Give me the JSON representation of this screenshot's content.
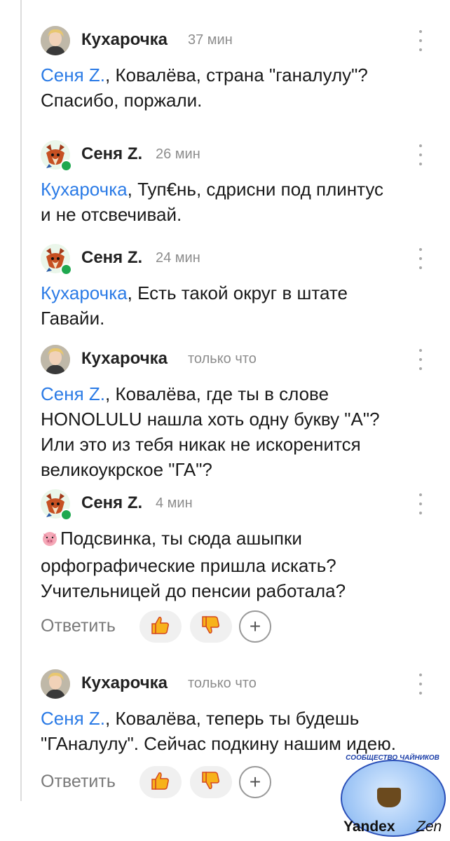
{
  "comments": [
    {
      "author": "Кухарочка",
      "time": "37 мин",
      "mention": "Сеня Z.",
      "text": ", Ковалёва, страна \"ганалулу\"?\nСпасибо, поржали."
    },
    {
      "author": "Сеня Z.",
      "time": "26 мин",
      "mention": "Кухарочка",
      "text": ", Туп€нь, сдрисни под плинтус\nи не отсвечивай."
    },
    {
      "author": "Сеня Z.",
      "time": "24 мин",
      "mention": "Кухарочка",
      "text": ", Есть такой округ в штате\nГавайи."
    },
    {
      "author": "Кухарочка",
      "time": "только что",
      "mention": "Сеня Z.",
      "text": ", Ковалёва, где ты в слове\nHONOLULU нашла хоть одну букву \"А\"?\nИли это из тебя никак не искоренится\nвеликоукрское \"ГА\"?"
    },
    {
      "author": "Сеня Z.",
      "time": "4 мин",
      "mention": "",
      "text": "Подсвинка, ты сюда ашыпки\nорфографические пришла искать?\nУчительницей до пенсии работала?"
    },
    {
      "author": "Кухарочка",
      "time": "только что",
      "mention": "Сеня Z.",
      "text": ", Ковалёва, теперь ты будешь\n\"ГАналулу\". Сейчас подкину нашим идею."
    }
  ],
  "actions": {
    "reply_label": "Ответить",
    "plus_label": "+"
  },
  "watermark": {
    "top": "СООБЩЕСТВО ЧАЙНИКОВ",
    "brand": "Yandex",
    "product": "Zen"
  }
}
